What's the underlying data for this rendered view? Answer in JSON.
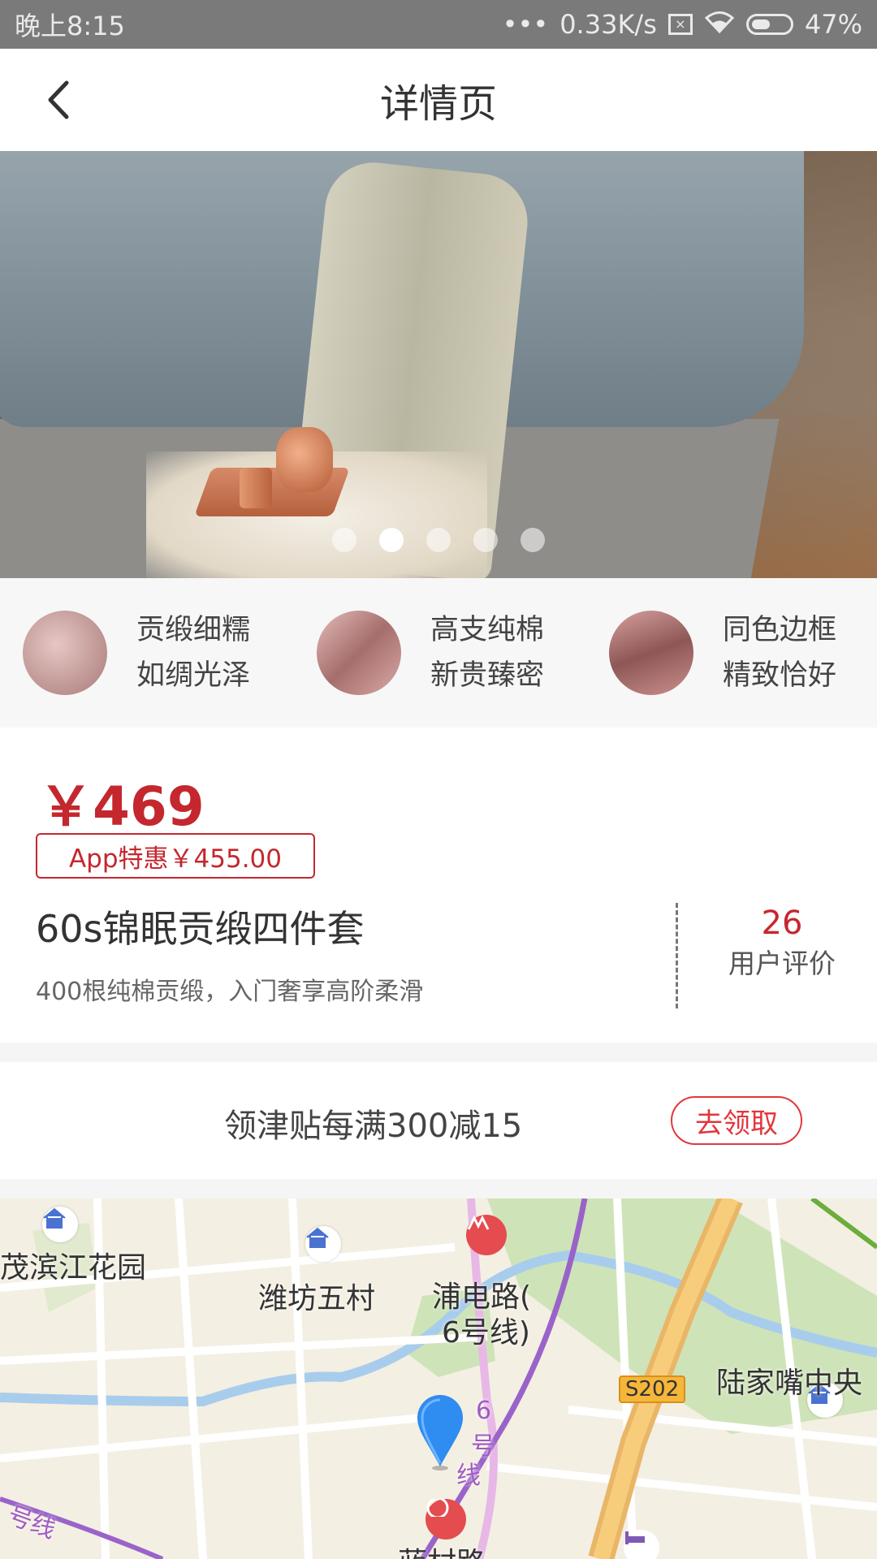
{
  "status_bar": {
    "time": "晚上8:15",
    "network_speed": "0.33K/s",
    "battery": "47%",
    "signal_dots": "•••"
  },
  "nav": {
    "title": "详情页"
  },
  "banner": {
    "slide_count": 5,
    "active_slide": 2
  },
  "features": [
    {
      "line1": "贡缎细糯",
      "line2": "如绸光泽",
      "thumb_color": "#c9a1a0"
    },
    {
      "line1": "高支纯棉",
      "line2": "新贵臻密",
      "thumb_color": "#c48f8d"
    },
    {
      "line1": "同色边框",
      "line2": "精致恰好",
      "thumb_color": "#b97f7d"
    }
  ],
  "product": {
    "price": "￥469",
    "app_price": "App特惠￥455.00",
    "name": "60s锦眠贡缎四件套",
    "subtitle": "400根纯棉贡缎，入门奢享高阶柔滑",
    "review_count": "26",
    "review_label": "用户评价"
  },
  "coupon": {
    "text": "领津贴每满300减15",
    "button": "去领取"
  },
  "map": {
    "labels": {
      "binjiang": "茂滨江花园",
      "weifang": "潍坊五村",
      "pudian_line1": "浦电路(",
      "pudian_line2": "6号线)",
      "lujiazui": "陆家嘴中央",
      "line6_char1": "6",
      "line6_char2": "号",
      "line6_char3": "线",
      "line_bottom": "号线",
      "station_bottom": "蓝村路",
      "road_s202": "S202"
    }
  },
  "colors": {
    "accent_red": "#c5272e",
    "coupon_red": "#e2363c",
    "status_bar": "#7a7a7a"
  }
}
